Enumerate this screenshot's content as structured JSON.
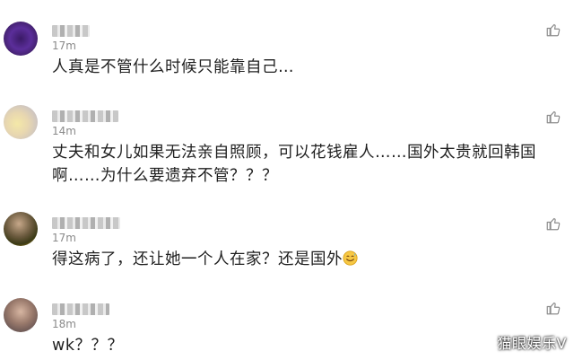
{
  "comments": [
    {
      "time": "17m",
      "text": "人真是不管什么时候只能靠自己…"
    },
    {
      "time": "14m",
      "text": "丈夫和女儿如果无法亲自照顾，可以花钱雇人……国外太贵就回韩国啊……为什么要遗弃不管？？？"
    },
    {
      "time": "17m",
      "text": "得这病了，还让她一个人在家？还是国外"
    },
    {
      "time": "18m",
      "text": "wk？？？"
    }
  ],
  "watermark": "猫眼娱乐V",
  "colors": {
    "like_icon": "#8c8c8c",
    "time_text": "#8a8a8a",
    "body_text": "#1f1f1f"
  },
  "icons": {
    "like": "thumbs-up-icon",
    "emoji": "sweat-smile-emoji-icon"
  }
}
